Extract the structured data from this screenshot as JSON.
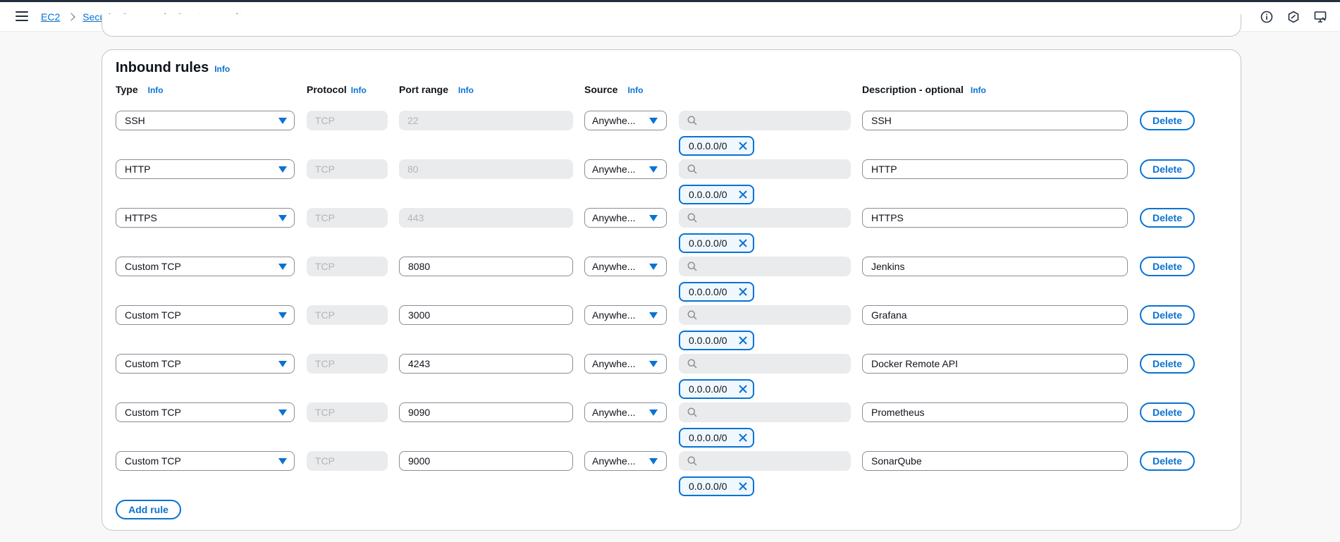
{
  "breadcrumbs": {
    "root": "EC2",
    "parent": "Security Groups",
    "current": "Create security group"
  },
  "header_icons": [
    "info-circle-icon",
    "settings-hex-icon",
    "display-feedback-icon"
  ],
  "inbound": {
    "title": "Inbound rules",
    "info_label": "Info",
    "columns": {
      "type": "Type",
      "protocol": "Protocol",
      "port_range": "Port range",
      "source": "Source",
      "description": "Description - optional"
    },
    "delete_label": "Delete",
    "add_rule_label": "Add rule",
    "rules": [
      {
        "type": "SSH",
        "protocol": "TCP",
        "port": "22",
        "port_editable": false,
        "source": "Anywhe...",
        "cidr": "0.0.0.0/0",
        "description": "SSH"
      },
      {
        "type": "HTTP",
        "protocol": "TCP",
        "port": "80",
        "port_editable": false,
        "source": "Anywhe...",
        "cidr": "0.0.0.0/0",
        "description": "HTTP"
      },
      {
        "type": "HTTPS",
        "protocol": "TCP",
        "port": "443",
        "port_editable": false,
        "source": "Anywhe...",
        "cidr": "0.0.0.0/0",
        "description": "HTTPS"
      },
      {
        "type": "Custom TCP",
        "protocol": "TCP",
        "port": "8080",
        "port_editable": true,
        "source": "Anywhe...",
        "cidr": "0.0.0.0/0",
        "description": "Jenkins"
      },
      {
        "type": "Custom TCP",
        "protocol": "TCP",
        "port": "3000",
        "port_editable": true,
        "source": "Anywhe...",
        "cidr": "0.0.0.0/0",
        "description": "Grafana"
      },
      {
        "type": "Custom TCP",
        "protocol": "TCP",
        "port": "4243",
        "port_editable": true,
        "source": "Anywhe...",
        "cidr": "0.0.0.0/0",
        "description": "Docker Remote API"
      },
      {
        "type": "Custom TCP",
        "protocol": "TCP",
        "port": "9090",
        "port_editable": true,
        "source": "Anywhe...",
        "cidr": "0.0.0.0/0",
        "description": "Prometheus"
      },
      {
        "type": "Custom TCP",
        "protocol": "TCP",
        "port": "9000",
        "port_editable": true,
        "source": "Anywhe...",
        "cidr": "0.0.0.0/0",
        "description": "SonarQube"
      }
    ]
  },
  "colors": {
    "accent": "#0972d3",
    "text": "#0f141a",
    "disabled_bg": "#e9ebed",
    "border": "#8c8c94"
  }
}
